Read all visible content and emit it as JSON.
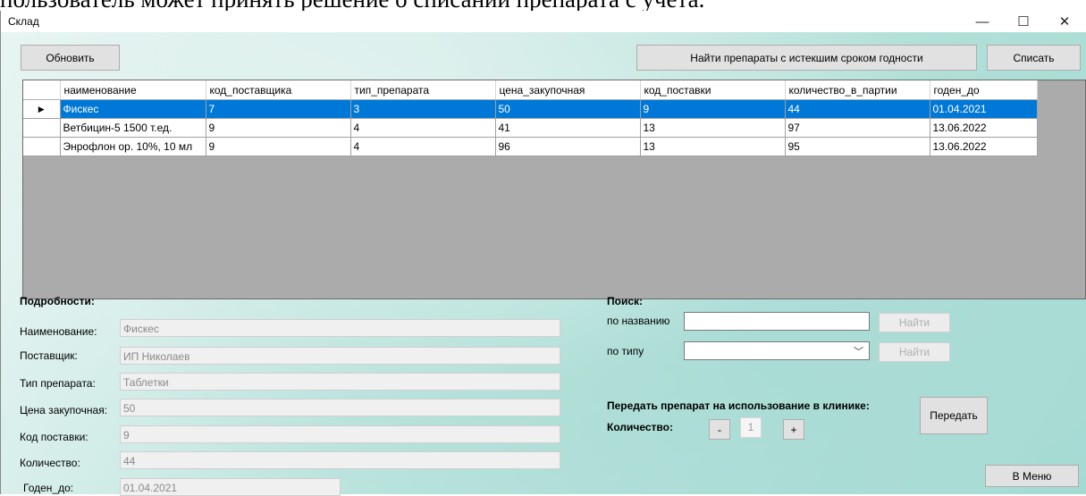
{
  "doc_text": "пользователь может принять решение о списании препарата с учета.",
  "window": {
    "title": "Склад",
    "minimize": "—",
    "maximize": "☐",
    "close": "✕"
  },
  "toolbar": {
    "refresh_label": "Обновить",
    "find_expired_label": "Найти препараты с истекшим сроком годности",
    "write_off_label": "Списать"
  },
  "table": {
    "columns": [
      "наименование",
      "код_поставщика",
      "тип_препарата",
      "цена_закупочная",
      "код_поставки",
      "количество_в_партии",
      "годен_до"
    ],
    "rows": [
      [
        "Фискес",
        "7",
        "3",
        "50",
        "9",
        "44",
        "01.04.2021"
      ],
      [
        "Ветбицин-5 1500 т.ед.",
        "9",
        "4",
        "41",
        "13",
        "97",
        "13.06.2022"
      ],
      [
        "Энрофлон ор. 10%, 10 мл",
        "9",
        "4",
        "96",
        "13",
        "95",
        "13.06.2022"
      ]
    ],
    "selected_row_marker": "▶"
  },
  "details": {
    "heading": "Подробности:",
    "name_label": "Наименование:",
    "name_value": "Фискес",
    "supplier_label": "Поставщик:",
    "supplier_value": "ИП Николаев",
    "type_label": "Тип препарата:",
    "type_value": "Таблетки",
    "price_label": "Цена закупочная:",
    "price_value": "50",
    "delivery_label": "Код поставки:",
    "delivery_value": "9",
    "quantity_label": "Количество:",
    "quantity_value": "44",
    "expiry_label": "Годен_до:",
    "expiry_value": "01.04.2021"
  },
  "search": {
    "heading": "Поиск:",
    "by_name_label": "по названию",
    "by_name_value": "",
    "by_type_label": "по типу",
    "by_type_value": "",
    "find_label": "Найти"
  },
  "transfer": {
    "heading": "Передать препарат на использование в клинике:",
    "quantity_label": "Количество:",
    "minus_label": "-",
    "quantity_value": "1",
    "plus_label": "+",
    "transfer_label": "Передать"
  },
  "menu_label": "В Меню"
}
